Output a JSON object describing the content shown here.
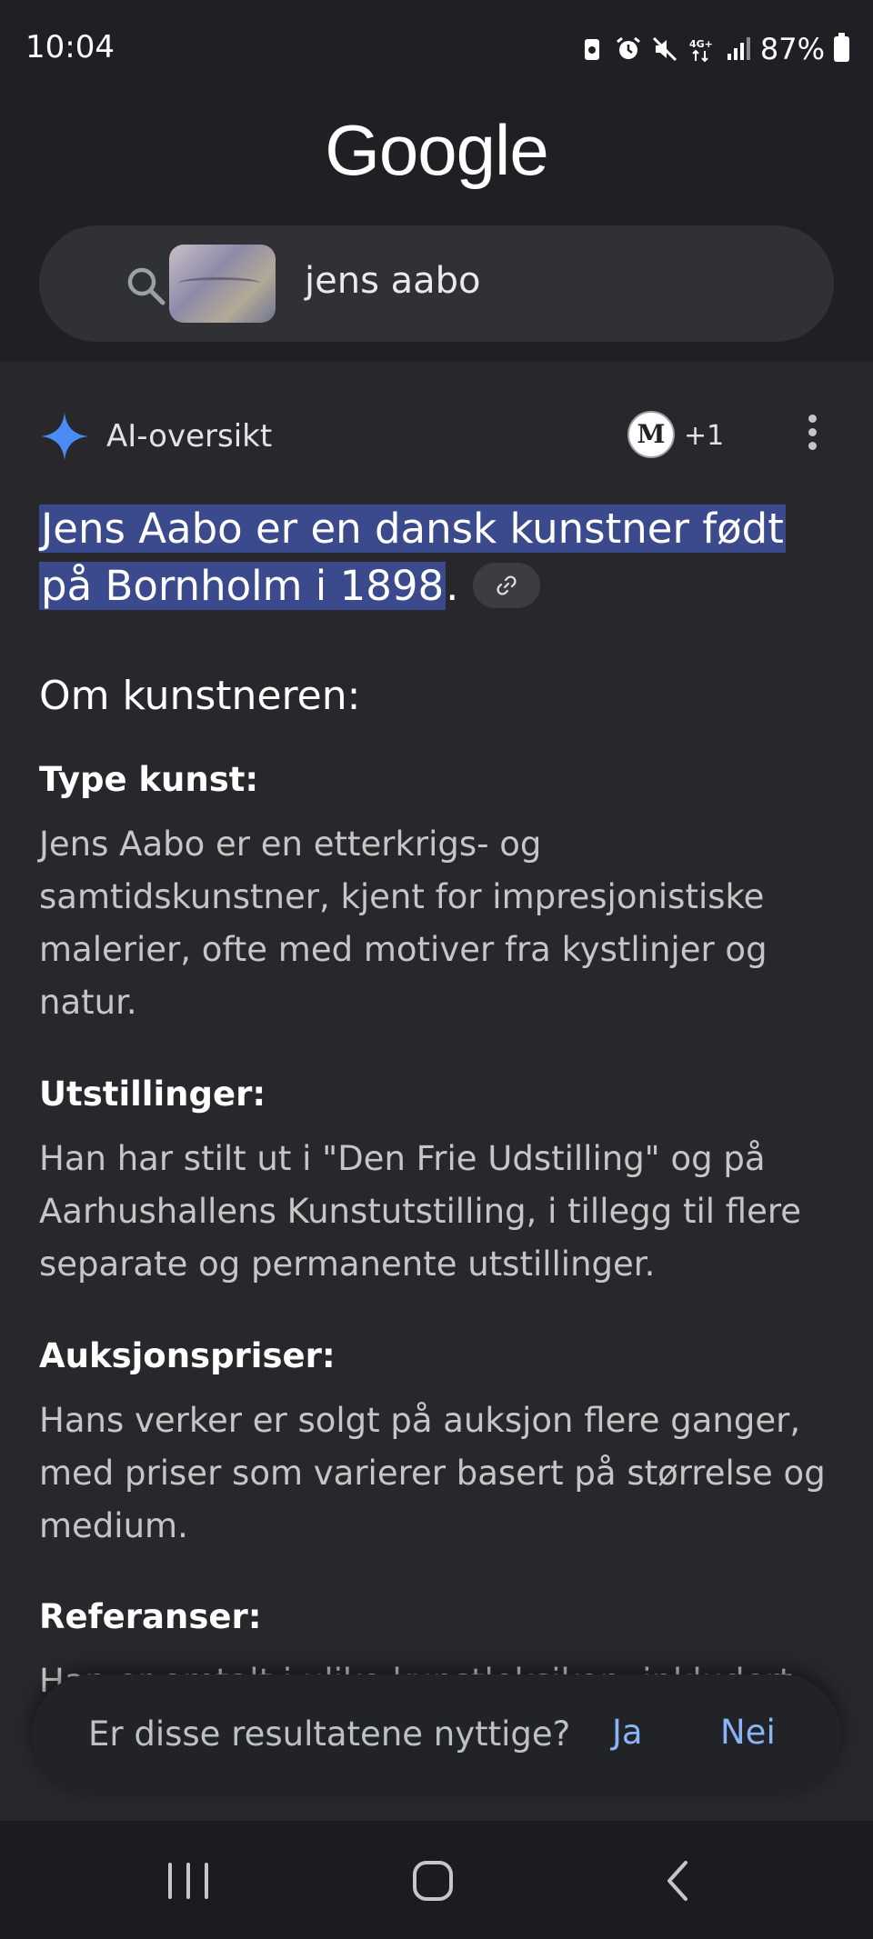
{
  "status_bar": {
    "time": "10:04",
    "battery": "87%",
    "icons": [
      "battery-saver-icon",
      "alarm-icon",
      "mute-icon",
      "4g-icon",
      "signal-icon",
      "battery-icon"
    ]
  },
  "header": {
    "logo": "Google",
    "search": {
      "query": "jens aabo",
      "thumbnail": "image-query-thumbnail"
    }
  },
  "ai_overview": {
    "title": "AI-oversikt",
    "source_avatar_letter": "M",
    "source_extra_count": "+1",
    "summary_highlight_line1": "Jens Aabo er en dansk kunstner født",
    "summary_highlight_line2": "på Bornholm i 1898",
    "summary_end": ".",
    "section_heading": "Om kunstneren:",
    "sections": [
      {
        "heading": "Type kunst:",
        "text": "Jens Aabo er en etterkrigs- og samtidskunstner, kjent for impresjonistiske malerier, ofte med motiver fra kystlinjer og natur."
      },
      {
        "heading": "Utstillinger:",
        "text": "Han har stilt ut i \"Den Frie Udstilling\" og på Aarhushallens Kunstutstilling, i tillegg til flere separate og permanente utstillinger."
      },
      {
        "heading": "Auksjonspriser:",
        "text": "Hans verker er solgt på auksjon flere ganger, med priser som varierer basert på størrelse og medium."
      },
      {
        "heading": "Referanser:",
        "text": "Han er omtalt i ulike kunstleksikon, inkludert"
      }
    ]
  },
  "feedback": {
    "question": "Er disse resultatene nyttige?",
    "yes": "Ja",
    "no": "Nei"
  },
  "colors": {
    "header_bg": "#1f2023",
    "page_bg": "#28282c",
    "highlight": "#3b4a8c",
    "link_blue": "#8ab4f8",
    "sparkle_blue": "#4a8cf7"
  }
}
